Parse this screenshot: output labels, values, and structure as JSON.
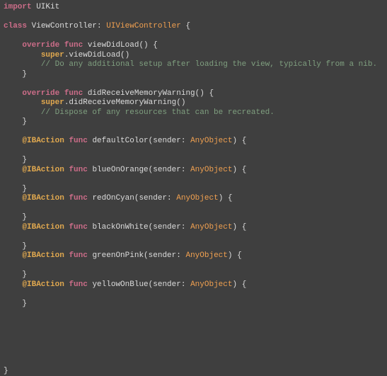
{
  "code": {
    "line0": "import UIKit",
    "line1": "",
    "kw_class": "class",
    "class_name": " ViewController: ",
    "type_uivc": "UIViewController",
    "brace_open": " {",
    "kw_override": "override",
    "kw_func": "func",
    "kw_super": "super",
    "kw_ibaction": "@IBAction",
    "type_anyobject": "AnyObject",
    "m_viewDidLoad_sig": " viewDidLoad() {",
    "m_super_vdl": ".viewDidLoad()",
    "comment_vdl": "// Do any additional setup after loading the view, typically from a nib.",
    "m_memwarn_sig": " didReceiveMemoryWarning() {",
    "m_super_mw": ".didReceiveMemoryWarning()",
    "comment_mw": "// Dispose of any resources that can be recreated.",
    "fn_default": " defaultColor(sender: ",
    "fn_blueorange": " blueOnOrange(sender: ",
    "fn_redcyan": " redOnCyan(sender: ",
    "fn_blackwhite": " blackOnWhite(sender: ",
    "fn_greenpink": " greenOnPink(sender: ",
    "fn_yellowblue": " yellowOnBlue(sender: ",
    "paren_brace": ") {",
    "close_brace": "}",
    "indent1": "    ",
    "indent2": "        "
  }
}
